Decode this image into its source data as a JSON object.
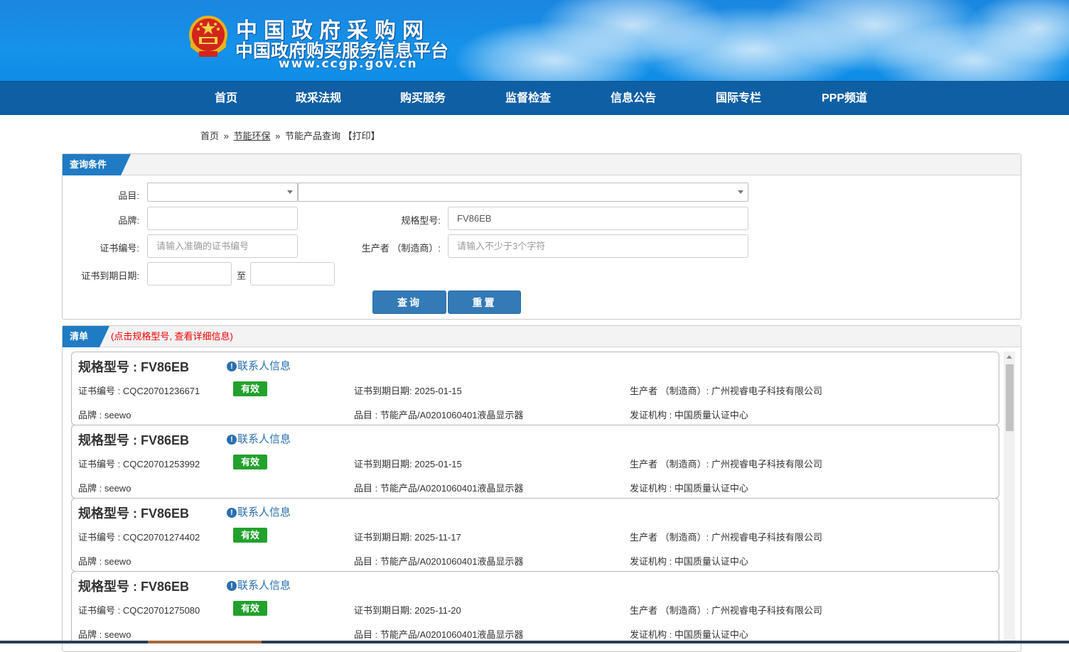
{
  "header": {
    "site_title": "中国政府采购网",
    "site_subtitle": "中国政府购买服务信息平台",
    "site_url": "www.ccgp.gov.cn"
  },
  "nav": {
    "items": [
      "首页",
      "政采法规",
      "购买服务",
      "监督检查",
      "信息公告",
      "国际专栏",
      "PPP频道"
    ]
  },
  "breadcrumb": {
    "home": "首页",
    "sep": "»",
    "section": "节能环保",
    "current": "节能产品查询",
    "print": "【打印】"
  },
  "query": {
    "title": "查询条件",
    "category_label": "品目:",
    "brand_label": "品牌:",
    "brand_value": "",
    "model_label": "规格型号:",
    "model_value": "FV86EB",
    "cert_label": "证书编号:",
    "cert_placeholder": "请输入准确的证书编号",
    "maker_label": "生产者 （制造商）:",
    "maker_placeholder": "请输入不少于3个字符",
    "expiry_label": "证书到期日期:",
    "to_label": "至",
    "search_button": "查询",
    "reset_button": "重置"
  },
  "list": {
    "title": "清单",
    "hint": "(点击规格型号, 查看详细信息)",
    "contact_label": "联系人信息",
    "model_prefix": "规格型号 : ",
    "cert_prefix": "证书编号 : ",
    "brand_prefix": "品牌 : ",
    "expiry_prefix": "证书到期日期: ",
    "category_prefix": "品目 : ",
    "maker_prefix": "生产者 （制造商）: ",
    "issuer_prefix": "发证机构 : ",
    "items": [
      {
        "model": "FV86EB",
        "cert": "CQC20701236671",
        "status": "有效",
        "expiry": "2025-01-15",
        "maker": "广州视睿电子科技有限公司",
        "brand": "seewo",
        "category": "节能产品/A0201060401液晶显示器",
        "issuer": "中国质量认证中心"
      },
      {
        "model": "FV86EB",
        "cert": "CQC20701253992",
        "status": "有效",
        "expiry": "2025-01-15",
        "maker": "广州视睿电子科技有限公司",
        "brand": "seewo",
        "category": "节能产品/A0201060401液晶显示器",
        "issuer": "中国质量认证中心"
      },
      {
        "model": "FV86EB",
        "cert": "CQC20701274402",
        "status": "有效",
        "expiry": "2025-11-17",
        "maker": "广州视睿电子科技有限公司",
        "brand": "seewo",
        "category": "节能产品/A0201060401液晶显示器",
        "issuer": "中国质量认证中心"
      },
      {
        "model": "FV86EB",
        "cert": "CQC20701275080",
        "status": "有效",
        "expiry": "2025-11-20",
        "maker": "广州视睿电子科技有限公司",
        "brand": "seewo",
        "category": "节能产品/A0201060401液晶显示器",
        "issuer": "中国质量认证中心"
      }
    ]
  },
  "colors": {
    "header_blue": "#1592ea",
    "nav_blue": "#0f5fa4",
    "tab_blue": "#1f7bc4",
    "button_blue": "#337ab7",
    "valid_green": "#22a12c",
    "hint_red": "#e00000",
    "link_blue": "#2a6fb0"
  }
}
